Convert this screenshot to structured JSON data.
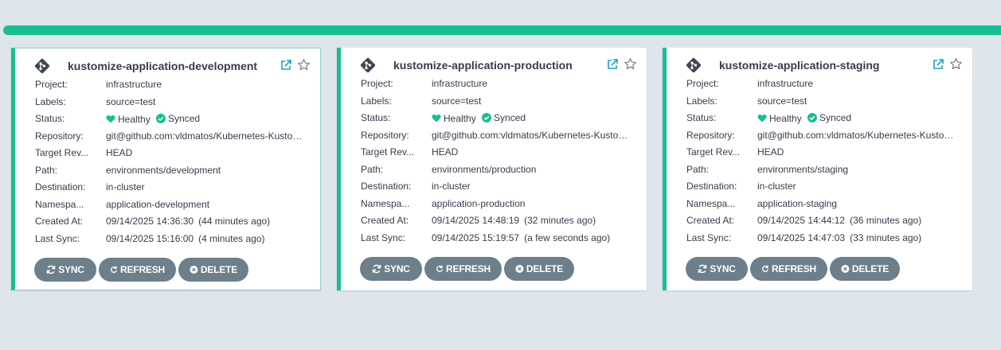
{
  "colors": {
    "healthy": "#18be94",
    "synced": "#18be94",
    "button": "#6d7f8b",
    "background": "#dee6eb"
  },
  "labels": {
    "project": "Project:",
    "labels": "Labels:",
    "status": "Status:",
    "repository": "Repository:",
    "target_revision": "Target Rev...",
    "path": "Path:",
    "destination": "Destination:",
    "namespace": "Namespa...",
    "created_at": "Created At:",
    "last_sync": "Last Sync:"
  },
  "buttons": {
    "sync": "SYNC",
    "refresh": "REFRESH",
    "delete": "DELETE"
  },
  "apps": [
    {
      "name": "kustomize-application-development",
      "project": "infrastructure",
      "labels": "source=test",
      "health": "Healthy",
      "sync": "Synced",
      "repository": "git@github.com:vldmatos/Kubernetes-Kustomize",
      "target_revision": "HEAD",
      "path": "environments/development",
      "destination": "in-cluster",
      "namespace": "application-development",
      "created_at": "09/14/2025 14:36:30",
      "created_ago": "(44 minutes ago)",
      "last_sync": "09/14/2025 15:16:00",
      "last_sync_ago": "(4 minutes ago)",
      "icons": [
        "git-icon",
        "external-link-icon",
        "star-icon",
        "heart-icon",
        "check-circle-icon",
        "sync-icon",
        "refresh-icon",
        "delete-icon"
      ]
    },
    {
      "name": "kustomize-application-production",
      "project": "infrastructure",
      "labels": "source=test",
      "health": "Healthy",
      "sync": "Synced",
      "repository": "git@github.com:vldmatos/Kubernetes-Kustomize",
      "target_revision": "HEAD",
      "path": "environments/production",
      "destination": "in-cluster",
      "namespace": "application-production",
      "created_at": "09/14/2025 14:48:19",
      "created_ago": "(32 minutes ago)",
      "last_sync": "09/14/2025 15:19:57",
      "last_sync_ago": "(a few seconds ago)"
    },
    {
      "name": "kustomize-application-staging",
      "project": "infrastructure",
      "labels": "source=test",
      "health": "Healthy",
      "sync": "Synced",
      "repository": "git@github.com:vldmatos/Kubernetes-Kustomize",
      "target_revision": "HEAD",
      "path": "environments/staging",
      "destination": "in-cluster",
      "namespace": "application-staging",
      "created_at": "09/14/2025 14:44:12",
      "created_ago": "(36 minutes ago)",
      "last_sync": "09/14/2025 14:47:03",
      "last_sync_ago": "(33 minutes ago)"
    }
  ]
}
